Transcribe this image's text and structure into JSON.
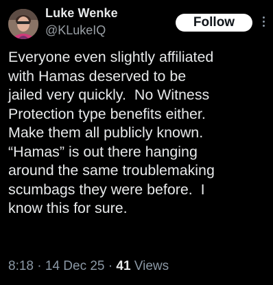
{
  "author": {
    "display_name": "Luke Wenke",
    "handle": "@KLukeIQ",
    "avatar_icon": "profile-photo"
  },
  "actions": {
    "follow_label": "Follow",
    "more_icon": "more-vertical-icon"
  },
  "tweet": {
    "text": "Everyone even slightly affiliated\nwith Hamas deserved to be\njailed very quickly.  No Witness\nProtection type benefits either.\nMake them all publicly known.\n“Hamas” is out there hanging\naround the same troublemaking\nscumbags they were before.  I\nknow this for sure."
  },
  "meta": {
    "time": "8:18",
    "separator": " · ",
    "date": "14 Dec 25",
    "views_count": "41",
    "views_label": " Views"
  },
  "colors": {
    "background": "#000000",
    "text_primary": "#e7e9ea",
    "text_secondary": "#8b98a5",
    "follow_bg": "#ffffff",
    "follow_text": "#0f1419"
  }
}
